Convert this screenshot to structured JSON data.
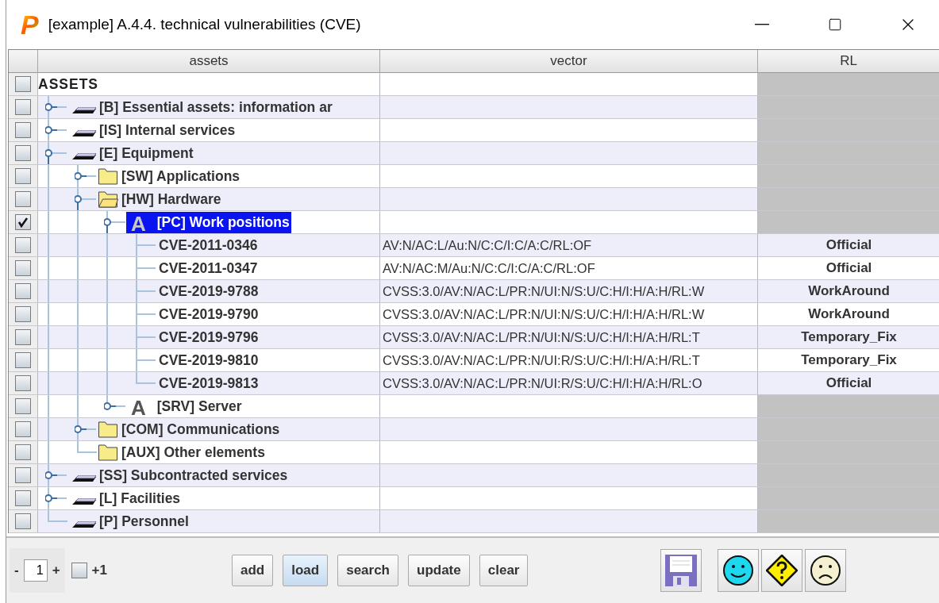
{
  "window": {
    "logo_text": "P",
    "title": "[example] A.4.4. technical vulnerabilities (CVE)"
  },
  "table": {
    "columns": [
      "assets",
      "vector",
      "RL"
    ],
    "tree": [
      {
        "label": "ASSETS",
        "checked": false,
        "selected": false,
        "kind": "root",
        "children": [
          {
            "label": "[B] Essential assets: information ar",
            "checked": false,
            "selected": false,
            "kind": "drawer",
            "expanded": false
          },
          {
            "label": "[IS] Internal services",
            "checked": false,
            "selected": false,
            "kind": "drawer",
            "expanded": false
          },
          {
            "label": "[E] Equipment",
            "checked": false,
            "selected": false,
            "kind": "drawer",
            "expanded": true,
            "children": [
              {
                "label": "[SW] Applications",
                "checked": false,
                "selected": false,
                "kind": "folder",
                "expanded": false
              },
              {
                "label": "[HW] Hardware",
                "checked": false,
                "selected": false,
                "kind": "folder",
                "expanded": true,
                "children": [
                  {
                    "label": "[PC] Work positions",
                    "checked": true,
                    "selected": true,
                    "kind": "letter",
                    "icon_text": "A",
                    "expanded": true,
                    "children": [
                      {
                        "label": "CVE-2011-0346",
                        "checked": false,
                        "selected": false,
                        "vector": "AV:N/AC:L/Au:N/C:C/I:C/A:C/RL:OF",
                        "rl": "Official"
                      },
                      {
                        "label": "CVE-2011-0347",
                        "checked": false,
                        "selected": false,
                        "vector": "AV:N/AC:M/Au:N/C:C/I:C/A:C/RL:OF",
                        "rl": "Official"
                      },
                      {
                        "label": "CVE-2019-9788",
                        "checked": false,
                        "selected": false,
                        "vector": "CVSS:3.0/AV:N/AC:L/PR:N/UI:N/S:U/C:H/I:H/A:H/RL:W",
                        "rl": "WorkAround"
                      },
                      {
                        "label": "CVE-2019-9790",
                        "checked": false,
                        "selected": false,
                        "vector": "CVSS:3.0/AV:N/AC:L/PR:N/UI:N/S:U/C:H/I:H/A:H/RL:W",
                        "rl": "WorkAround"
                      },
                      {
                        "label": "CVE-2019-9796",
                        "checked": false,
                        "selected": false,
                        "vector": "CVSS:3.0/AV:N/AC:L/PR:N/UI:N/S:U/C:H/I:H/A:H/RL:T",
                        "rl": "Temporary_Fix"
                      },
                      {
                        "label": "CVE-2019-9810",
                        "checked": false,
                        "selected": false,
                        "vector": "CVSS:3.0/AV:N/AC:L/PR:N/UI:R/S:U/C:H/I:H/A:H/RL:T",
                        "rl": "Temporary_Fix"
                      },
                      {
                        "label": "CVE-2019-9813",
                        "checked": false,
                        "selected": false,
                        "vector": "CVSS:3.0/AV:N/AC:L/PR:N/UI:R/S:U/C:H/I:H/A:H/RL:O",
                        "rl": "Official"
                      }
                    ]
                  },
                  {
                    "label": "[SRV] Server",
                    "checked": false,
                    "selected": false,
                    "kind": "letter",
                    "icon_text": "A",
                    "expanded": false
                  }
                ]
              },
              {
                "label": "[COM] Communications",
                "checked": false,
                "selected": false,
                "kind": "folder",
                "expanded": false
              },
              {
                "label": "[AUX] Other elements",
                "checked": false,
                "selected": false,
                "kind": "folder"
              }
            ]
          },
          {
            "label": "[SS] Subcontracted services",
            "checked": false,
            "selected": false,
            "kind": "drawer",
            "expanded": false
          },
          {
            "label": "[L] Facilities",
            "checked": false,
            "selected": false,
            "kind": "drawer",
            "expanded": false
          },
          {
            "label": "[P] Personnel",
            "checked": false,
            "selected": false,
            "kind": "drawer"
          }
        ]
      }
    ]
  },
  "toolbar": {
    "minus": "-",
    "counter": "1",
    "plus": "+",
    "increment": {
      "label": "+1",
      "checked": false
    },
    "buttons": [
      {
        "label": "add",
        "highlighted": false
      },
      {
        "label": "load",
        "highlighted": true
      },
      {
        "label": "search",
        "highlighted": false
      },
      {
        "label": "update",
        "highlighted": false
      },
      {
        "label": "clear",
        "highlighted": false
      }
    ]
  }
}
